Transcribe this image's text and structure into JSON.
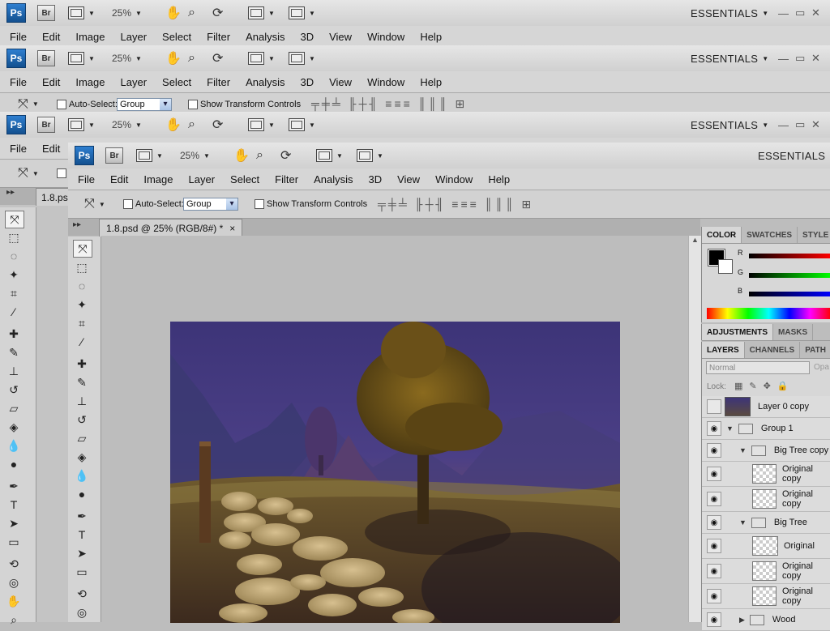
{
  "app": {
    "logo": "Ps",
    "bridge": "Br",
    "zoom": "25%",
    "workspace": "ESSENTIALS",
    "window_controls": [
      "—",
      "▭",
      "✕"
    ]
  },
  "menu": [
    "File",
    "Edit",
    "Image",
    "Layer",
    "Select",
    "Filter",
    "Analysis",
    "3D",
    "View",
    "Window",
    "Help"
  ],
  "options": {
    "auto_select": "Auto-Select:",
    "auto_select_value": "Group",
    "show_transform": "Show Transform Controls"
  },
  "document": {
    "tab_title": "1.8.psd @ 25% (RGB/8#) *",
    "tab_title_short": "1.8.ps",
    "close": "×"
  },
  "color_panel": {
    "tabs": [
      "COLOR",
      "SWATCHES",
      "STYLE"
    ],
    "channels": [
      "R",
      "G",
      "B"
    ]
  },
  "adjust_panel": {
    "tabs": [
      "ADJUSTMENTS",
      "MASKS"
    ]
  },
  "layers_panel": {
    "tabs": [
      "LAYERS",
      "CHANNELS",
      "PATH"
    ],
    "blend_mode": "Normal",
    "opacity_label": "Opa",
    "lock_label": "Lock:",
    "layers": [
      {
        "name": "Layer 0 copy",
        "kind": "image",
        "visible": false,
        "indent": 0
      },
      {
        "name": "Group 1",
        "kind": "group",
        "visible": true,
        "indent": 0
      },
      {
        "name": "Big Tree copy",
        "kind": "group",
        "visible": true,
        "indent": 1
      },
      {
        "name": "Original copy",
        "kind": "layer",
        "visible": true,
        "indent": 2
      },
      {
        "name": "Original copy",
        "kind": "layer",
        "visible": true,
        "indent": 2
      },
      {
        "name": "Big Tree",
        "kind": "group",
        "visible": true,
        "indent": 1
      },
      {
        "name": "Original",
        "kind": "layer",
        "visible": true,
        "indent": 2
      },
      {
        "name": "Original copy",
        "kind": "layer",
        "visible": true,
        "indent": 2
      },
      {
        "name": "Original copy",
        "kind": "layer",
        "visible": true,
        "indent": 2
      },
      {
        "name": "Wood",
        "kind": "group",
        "visible": true,
        "indent": 1
      }
    ]
  },
  "icons": {
    "hand": "✋",
    "zoom": "🔍",
    "rotate": "⟳",
    "arrange": "▤",
    "screen": "▣",
    "eye": "👁"
  }
}
